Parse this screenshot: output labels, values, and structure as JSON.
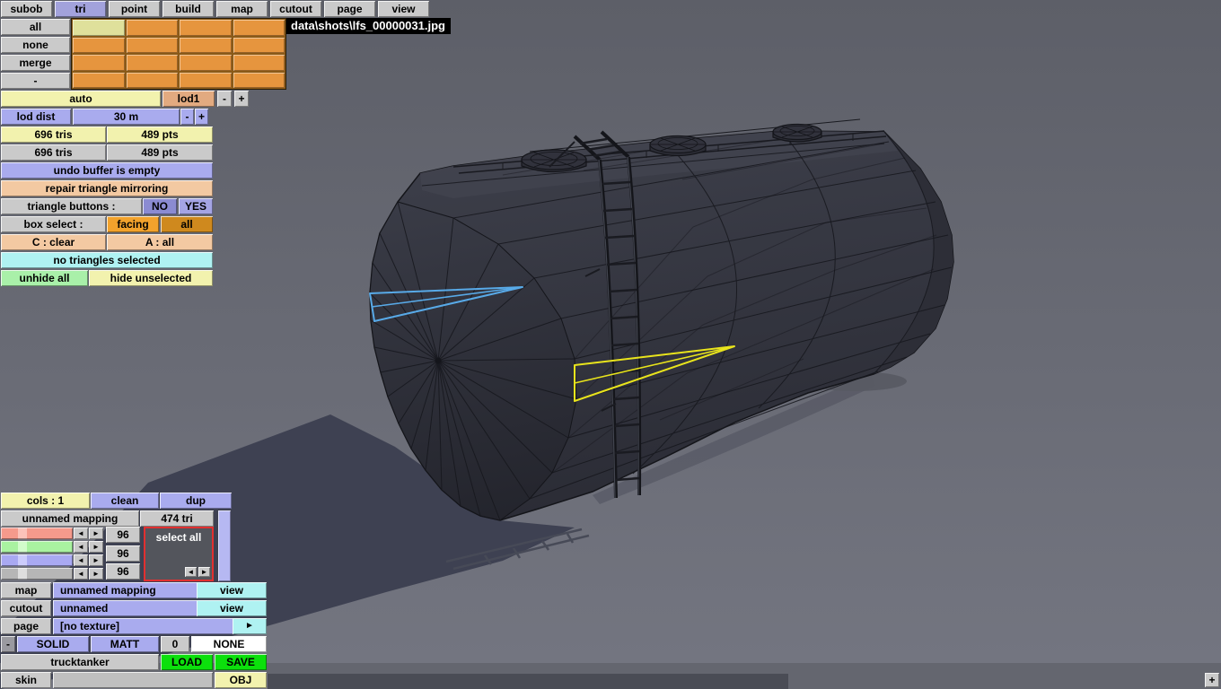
{
  "viewport": {
    "title": "data\\shots\\lfs_00000031.jpg",
    "colors": {
      "background_top": "#5d5f68",
      "background_bottom": "#747681",
      "shadow": "#3e4152",
      "tank_body": "#33343e",
      "wireframe": "#16171d",
      "highlight_blue": "#58aae8",
      "highlight_yellow": "#e9e41c"
    }
  },
  "tabs": [
    {
      "label": "subob"
    },
    {
      "label": "tri",
      "selected": true
    },
    {
      "label": "point"
    },
    {
      "label": "build"
    },
    {
      "label": "map"
    },
    {
      "label": "cutout"
    },
    {
      "label": "page"
    },
    {
      "label": "view"
    }
  ],
  "selection_grid": {
    "buttons": [
      {
        "label": "all"
      },
      {
        "label": "none"
      },
      {
        "label": "merge"
      },
      {
        "label": "-"
      }
    ]
  },
  "lod_row": {
    "auto": "auto",
    "lod": "lod1",
    "minus": "-",
    "plus": "+"
  },
  "lod_dist_row": {
    "label": "lod dist",
    "value": "30 m",
    "minus": "-",
    "plus": "+"
  },
  "stats_rows": [
    {
      "tris": "696 tris",
      "pts": "489 pts"
    },
    {
      "tris": "696 tris",
      "pts": "489 pts"
    }
  ],
  "undo_row": {
    "label": "undo buffer is empty"
  },
  "repair_row": {
    "label": "repair triangle mirroring"
  },
  "triangle_buttons_row": {
    "label": "triangle buttons :",
    "no": "NO",
    "yes": "YES"
  },
  "box_select_row": {
    "label": "box select :",
    "facing": "facing",
    "all": "all"
  },
  "clear_row": {
    "clear": "C : clear",
    "all": "A : all"
  },
  "selection_status_row": {
    "label": "no triangles selected"
  },
  "hide_row": {
    "unhide": "unhide all",
    "hide": "hide unselected"
  },
  "mapping_panel": {
    "cols": "cols : 1",
    "clean": "clean",
    "dup": "dup",
    "name": "unnamed mapping",
    "tri_count": "474 tri",
    "select_all": "select all",
    "values": [
      "96",
      "96",
      "96"
    ],
    "arrow_left": "◄",
    "arrow_right": "►"
  },
  "texture_panel": {
    "rows": [
      {
        "label": "map",
        "value": "unnamed mapping",
        "action": "view"
      },
      {
        "label": "cutout",
        "value": "unnamed",
        "action": "view"
      },
      {
        "label": "page",
        "value": "[no texture]",
        "action": "►"
      }
    ],
    "material_row": {
      "minus": "-",
      "solid": "SOLID",
      "matt": "MATT",
      "count": "0",
      "none": "NONE"
    }
  },
  "file_panel": {
    "name": "trucktanker",
    "load": "LOAD",
    "save": "SAVE",
    "skin": "skin",
    "obj": "OBJ"
  },
  "bottom_bar": {
    "plus": "+"
  }
}
